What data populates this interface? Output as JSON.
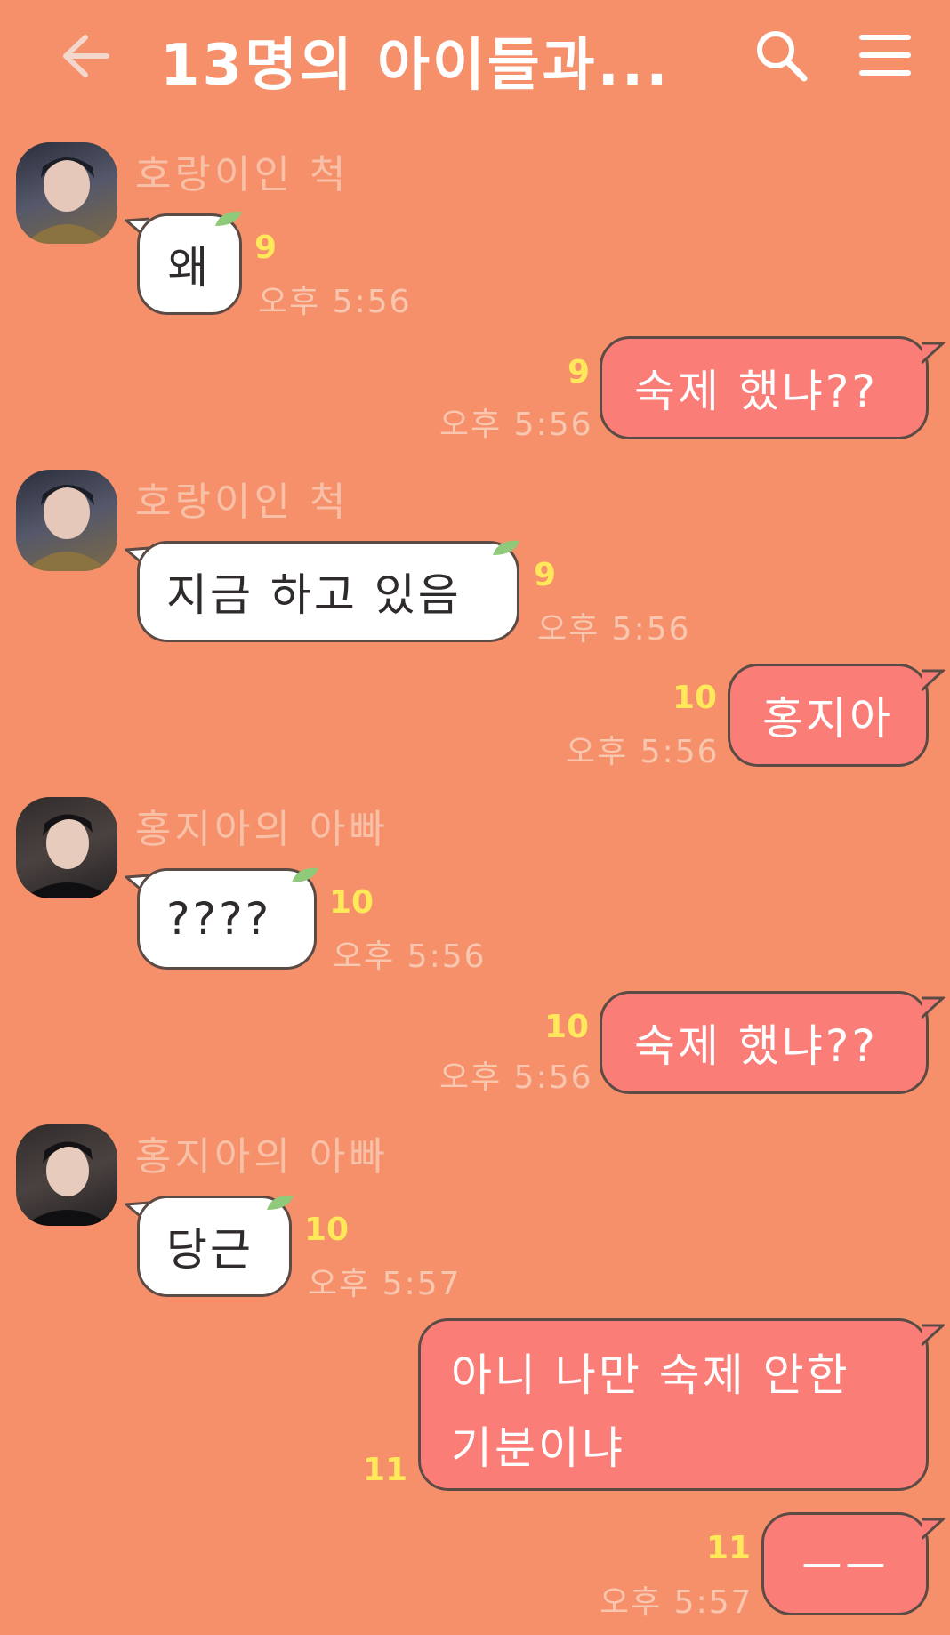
{
  "header": {
    "title": "13명의 아이들과...",
    "back_icon": "back-arrow-icon",
    "search_icon": "search-icon",
    "menu_icon": "menu-icon"
  },
  "messages": [
    {
      "sender": "호랑이인 척",
      "text": "왜",
      "unread": "9",
      "time": "오후 5:56"
    },
    {
      "text": "숙제 했냐??",
      "unread": "9",
      "time": "오후 5:56"
    },
    {
      "sender": "호랑이인 척",
      "text": "지금 하고 있음",
      "unread": "9",
      "time": "오후 5:56"
    },
    {
      "text": "홍지아",
      "unread": "10",
      "time": "오후 5:56"
    },
    {
      "sender": "홍지아의 아빠",
      "text": "????",
      "unread": "10",
      "time": "오후 5:56"
    },
    {
      "text": "숙제 했냐??",
      "unread": "10",
      "time": "오후 5:56"
    },
    {
      "sender": "홍지아의 아빠",
      "text": "당근",
      "unread": "10",
      "time": "오후 5:57"
    },
    {
      "text_line1": "아니 나만 숙제 안한",
      "text_line2": "기분이냐",
      "unread": "11"
    },
    {
      "text": "ㅡㅡ",
      "unread": "11",
      "time": "오후 5:57"
    }
  ]
}
